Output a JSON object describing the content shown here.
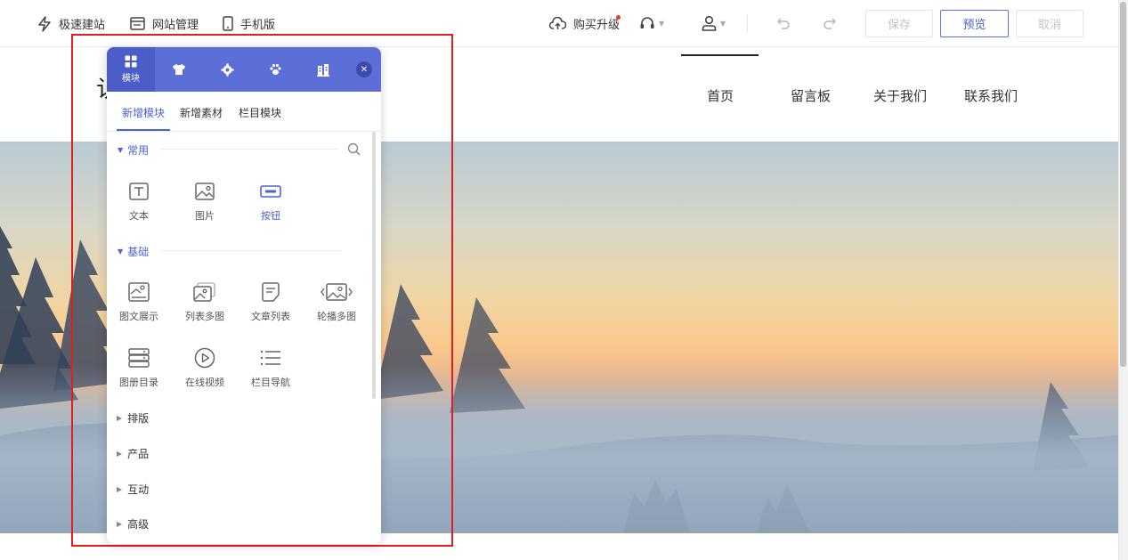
{
  "toolbar": {
    "quick_build": "极速建站",
    "site_manage": "网站管理",
    "mobile": "手机版",
    "upgrade": "购买升级",
    "save": "保存",
    "preview": "预览",
    "cancel": "取消",
    "icons": {
      "quick_build": "lightning-icon",
      "site_manage": "browser-window-icon",
      "mobile": "phone-icon",
      "upgrade": "cloud-upload-icon",
      "support": "headset-icon",
      "account": "user-icon",
      "undo": "undo-icon",
      "redo": "redo-icon"
    }
  },
  "site": {
    "logo_partial": "认",
    "nav": [
      "首页",
      "留言板",
      "关于我们",
      "联系我们"
    ],
    "active_nav_index": 0
  },
  "panel": {
    "active_tab_label": "模块",
    "tab_icons": [
      "grid-icon",
      "shirt-icon",
      "gear-icon",
      "paw-icon",
      "building-icon"
    ],
    "subtabs": [
      "新增模块",
      "新增素材",
      "栏目模块"
    ],
    "active_subtab_index": 0,
    "sections": {
      "common": {
        "title": "常用",
        "items": [
          {
            "label": "文本",
            "icon": "text-icon"
          },
          {
            "label": "图片",
            "icon": "image-icon"
          },
          {
            "label": "按钮",
            "icon": "button-icon"
          }
        ]
      },
      "basic": {
        "title": "基础",
        "items": [
          {
            "label": "图文展示",
            "icon": "image-text-icon"
          },
          {
            "label": "列表多图",
            "icon": "multi-image-icon"
          },
          {
            "label": "文章列表",
            "icon": "article-list-icon"
          },
          {
            "label": "轮播多图",
            "icon": "carousel-icon"
          },
          {
            "label": "图册目录",
            "icon": "album-icon"
          },
          {
            "label": "在线视频",
            "icon": "play-icon"
          },
          {
            "label": "栏目导航",
            "icon": "list-nav-icon"
          }
        ]
      }
    },
    "collapsed_sections": [
      "排版",
      "产品",
      "互动",
      "高级"
    ]
  },
  "colors": {
    "accent": "#4a63d4",
    "panel_header": "#5b6fd6",
    "highlight": "#e02020"
  }
}
